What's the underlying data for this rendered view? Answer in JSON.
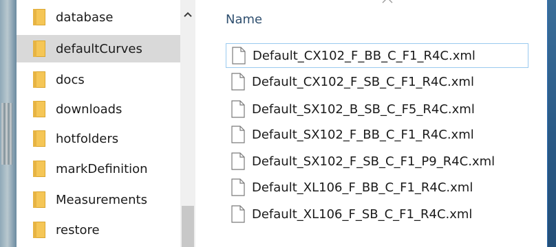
{
  "navigation": {
    "folders": [
      {
        "label": "database",
        "icon": "folder-icon",
        "selected": false
      },
      {
        "label": "defaultCurves",
        "icon": "folder-icon",
        "selected": true
      },
      {
        "label": "docs",
        "icon": "folder-icon",
        "selected": false
      },
      {
        "label": "downloads",
        "icon": "folder-icon",
        "selected": false
      },
      {
        "label": "hotfolders",
        "icon": "folder-icon",
        "selected": false
      },
      {
        "label": "markDefinition",
        "icon": "folder-icon",
        "selected": false
      },
      {
        "label": "Measurements",
        "icon": "folder-icon",
        "selected": false
      },
      {
        "label": "restore",
        "icon": "folder-icon",
        "selected": false
      }
    ]
  },
  "content": {
    "column_header": "Name",
    "files": [
      {
        "name": "Default_CX102_F_BB_C_F1_R4C.xml",
        "icon": "document-icon",
        "focused": true
      },
      {
        "name": "Default_CX102_F_SB_C_F1_R4C.xml",
        "icon": "document-icon",
        "focused": false
      },
      {
        "name": "Default_SX102_B_SB_C_F5_R4C.xml",
        "icon": "document-icon",
        "focused": false
      },
      {
        "name": "Default_SX102_F_BB_C_F1_R4C.xml",
        "icon": "document-icon",
        "focused": false
      },
      {
        "name": "Default_SX102_F_SB_C_F1_P9_R4C.xml",
        "icon": "document-icon",
        "focused": false
      },
      {
        "name": "Default_XL106_F_BB_C_F1_R4C.xml",
        "icon": "document-icon",
        "focused": false
      },
      {
        "name": "Default_XL106_F_SB_C_F1_R4C.xml",
        "icon": "document-icon",
        "focused": false
      }
    ]
  },
  "colors": {
    "selection": "#d9d9d9",
    "focus_border": "#99c9ef",
    "folder": "#f5c656",
    "header_text": "#2f4f6f"
  }
}
